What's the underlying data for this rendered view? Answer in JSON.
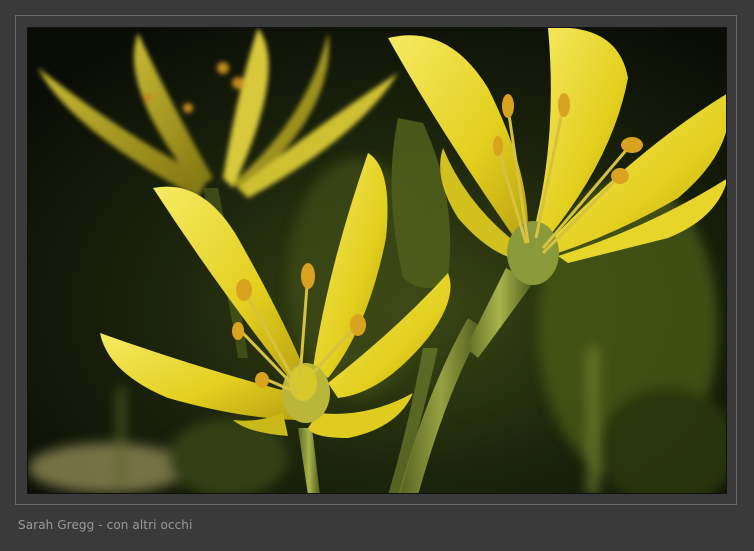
{
  "photo": {
    "subject": "yellow-star-flowers",
    "colors": {
      "background_dark": "#0f140a",
      "petal_yellow": "#e8d62a",
      "petal_light": "#f3e75a",
      "stamen_orange": "#d9a21f",
      "stem_green": "#8a9a3a"
    }
  },
  "caption": {
    "text": "Sarah Gregg - con altri occhi"
  },
  "colors": {
    "page_background": "#3a3a3a",
    "frame_border": "#6a6a6a",
    "caption_text": "#9a9a9a"
  }
}
